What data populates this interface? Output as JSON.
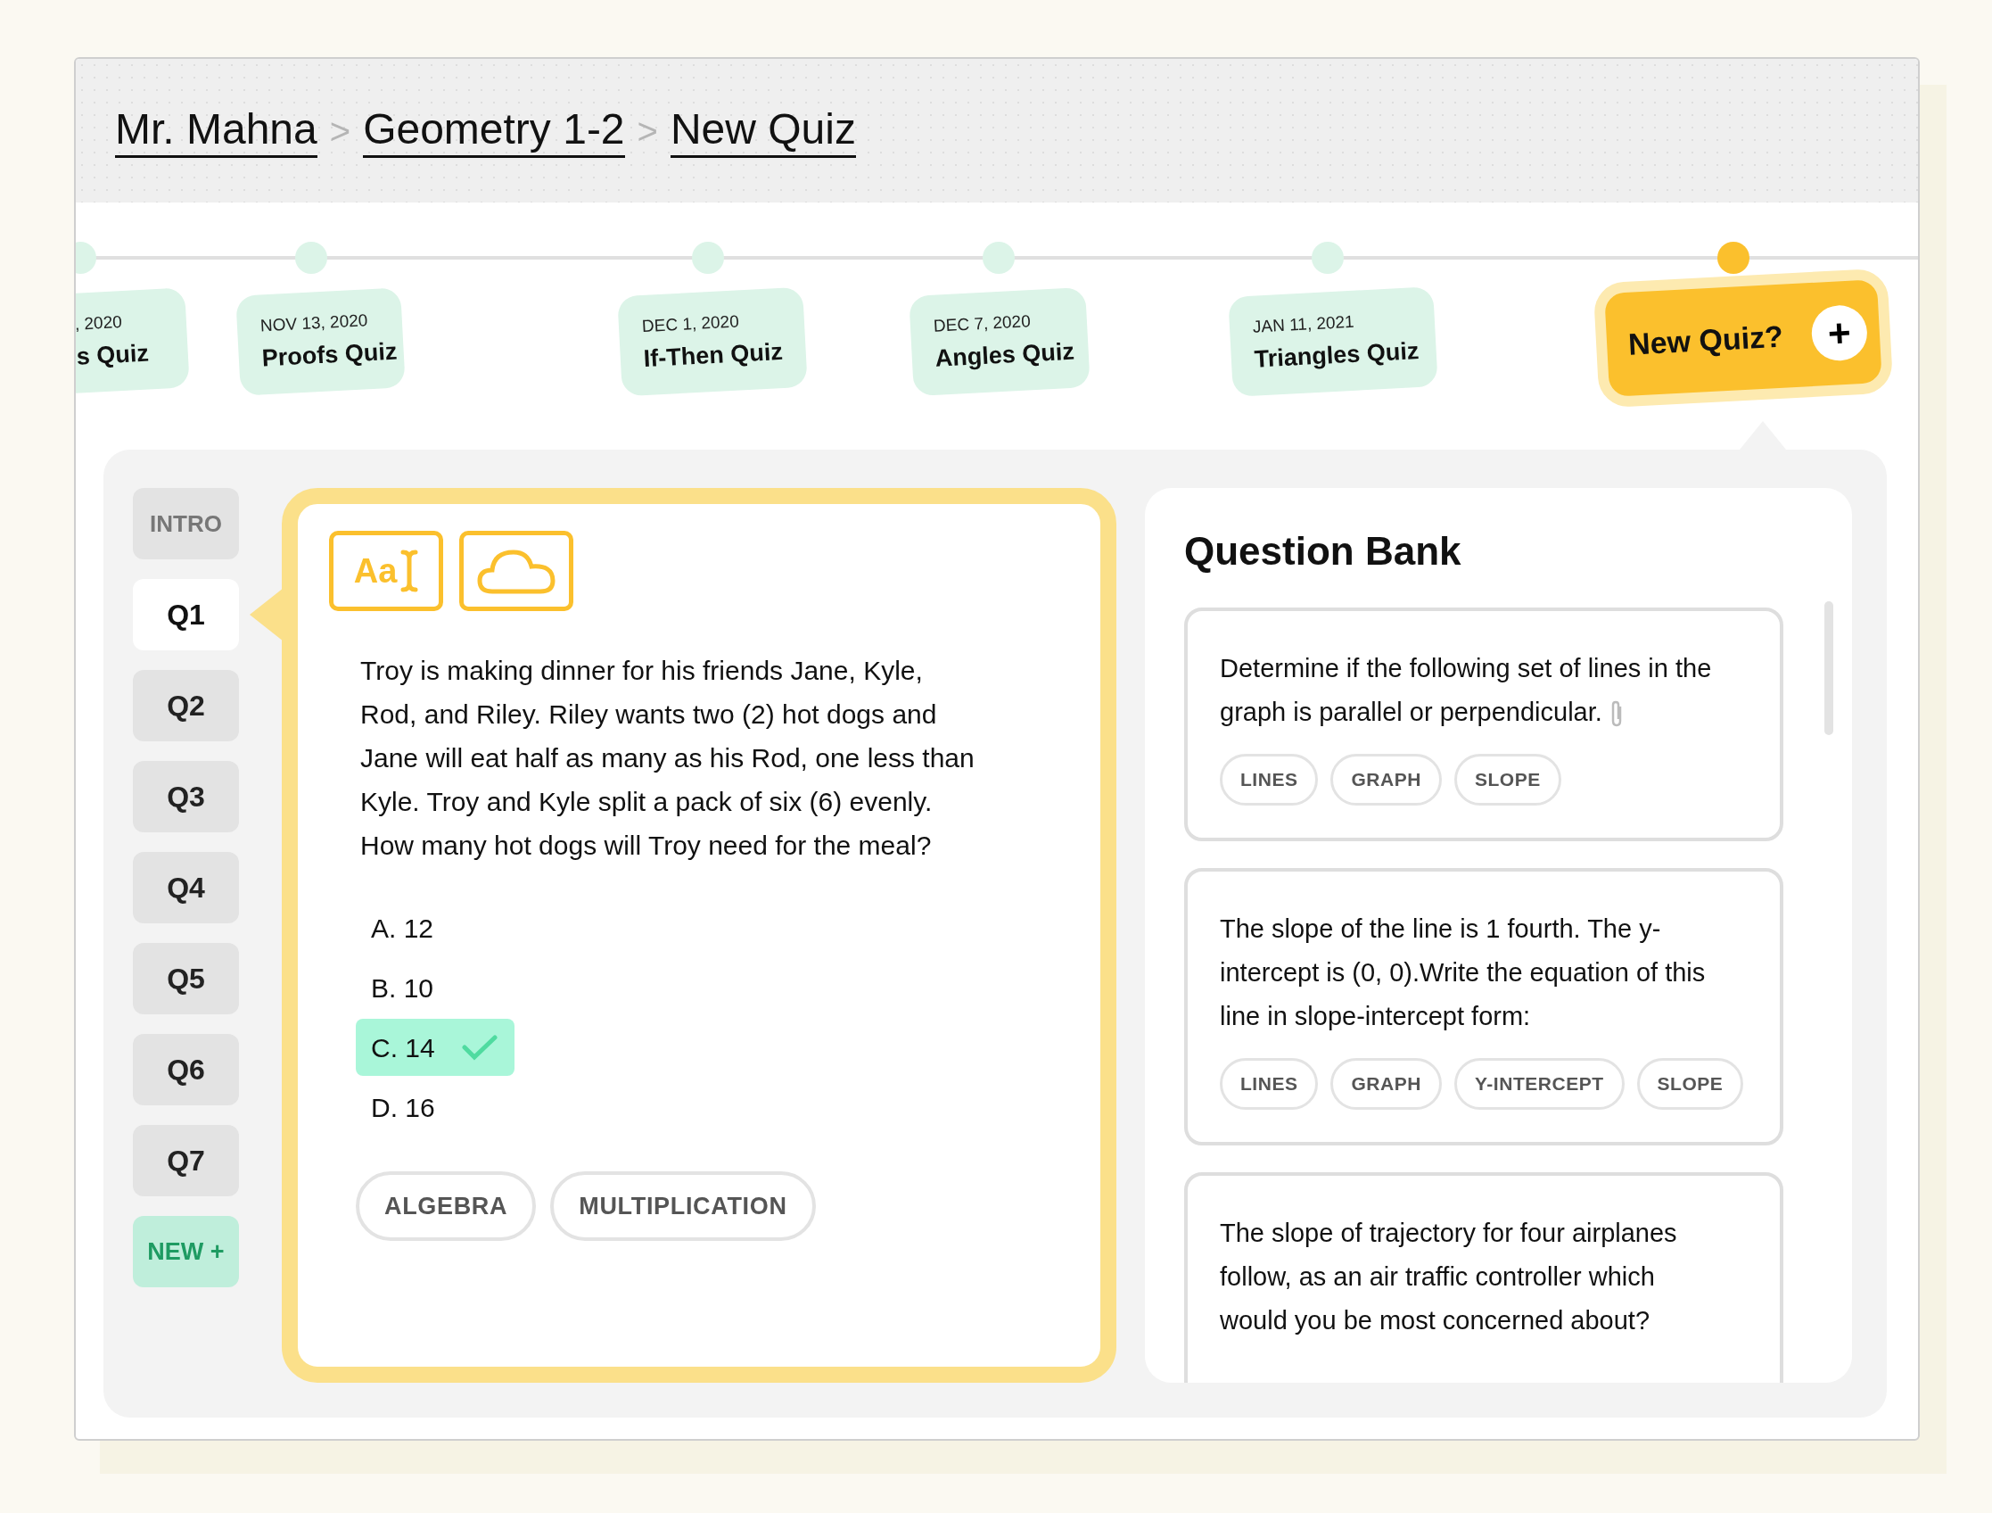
{
  "breadcrumb": {
    "separator": ">",
    "items": [
      {
        "label": "Mr. Mahna"
      },
      {
        "label": "Geometry 1-2"
      },
      {
        "label": "New Quiz"
      }
    ]
  },
  "timeline": [
    {
      "kind": "quiz",
      "date": ", 2020",
      "title": "s Quiz"
    },
    {
      "kind": "quiz",
      "date": "NOV 13, 2020",
      "title": "Proofs Quiz"
    },
    {
      "kind": "quiz",
      "date": "DEC 1, 2020",
      "title": "If-Then Quiz"
    },
    {
      "kind": "quiz",
      "date": "DEC 7, 2020",
      "title": "Angles Quiz"
    },
    {
      "kind": "quiz",
      "date": "JAN 11, 2021",
      "title": "Triangles Quiz"
    },
    {
      "kind": "new",
      "title": "New Quiz?",
      "icon": "+"
    }
  ],
  "sidebar": {
    "items": [
      {
        "kind": "section",
        "label": "INTRO",
        "selected": false
      },
      {
        "kind": "question",
        "label": "Q1",
        "selected": true
      },
      {
        "kind": "question",
        "label": "Q2",
        "selected": false
      },
      {
        "kind": "question",
        "label": "Q3",
        "selected": false
      },
      {
        "kind": "question",
        "label": "Q4",
        "selected": false
      },
      {
        "kind": "question",
        "label": "Q5",
        "selected": false
      },
      {
        "kind": "question",
        "label": "Q6",
        "selected": false
      },
      {
        "kind": "question",
        "label": "Q7",
        "selected": false
      }
    ],
    "new_button": "NEW +"
  },
  "question": {
    "tools": [
      {
        "kind": "text",
        "label": "Aa"
      },
      {
        "kind": "cloud"
      }
    ],
    "text": "Troy is making dinner for his friends Jane, Kyle, Rod, and Riley. Riley wants two (2) hot dogs and Jane will eat half as many as his Rod, one less than Kyle. Troy and Kyle split a pack of six (6) evenly. How many hot dogs will Troy need for the meal?",
    "choices": [
      {
        "label": "A. 12",
        "correct": false
      },
      {
        "label": "B. 10",
        "correct": false
      },
      {
        "label": "C. 14",
        "correct": true
      },
      {
        "label": "D. 16",
        "correct": false
      }
    ],
    "tags": [
      "ALGEBRA",
      "MULTIPLICATION"
    ]
  },
  "question_bank": {
    "title": "Question Bank",
    "items": [
      {
        "text": "Determine if the following set of lines in the graph is parallel or perpendicular.",
        "attachment": true,
        "tags": [
          "LINES",
          "GRAPH",
          "SLOPE"
        ]
      },
      {
        "text": "The slope of the line is 1 fourth. The y-intercept is (0, 0).Write the equation of this line in slope-intercept form:",
        "attachment": false,
        "tags": [
          "LINES",
          "GRAPH",
          "Y-INTERCEPT",
          "SLOPE"
        ]
      },
      {
        "text": "The slope of trajectory for four airplanes follow, as an air traffic controller which would you be most concerned about?",
        "attachment": false
      }
    ]
  }
}
